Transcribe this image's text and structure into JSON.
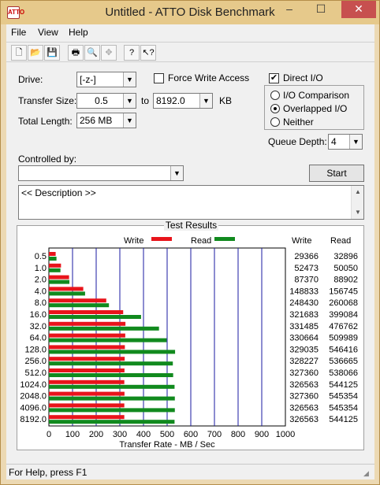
{
  "window": {
    "title": "Untitled - ATTO Disk Benchmark",
    "app_icon_glyph": "ATTO",
    "minimize": "–",
    "maximize": "☐",
    "close": "✕"
  },
  "menu": [
    "File",
    "View",
    "Help"
  ],
  "toolbar": [
    {
      "name": "new-icon",
      "glyph": "🗋"
    },
    {
      "name": "open-icon",
      "glyph": "📂"
    },
    {
      "name": "save-icon",
      "glyph": "💾"
    },
    {
      "name": "print-icon",
      "glyph": "🖶"
    },
    {
      "name": "print-preview-icon",
      "glyph": "🔍"
    },
    {
      "name": "move-icon",
      "glyph": "✥"
    },
    {
      "name": "help-icon",
      "glyph": "?"
    },
    {
      "name": "context-help-icon",
      "glyph": "↖?"
    }
  ],
  "settings": {
    "drive_label": "Drive:",
    "drive_value": "[-z-]",
    "transfer_size_label": "Transfer Size:",
    "transfer_from": "0.5",
    "to_label": "to",
    "transfer_to": "8192.0",
    "unit": "KB",
    "total_length_label": "Total Length:",
    "total_length_value": "256 MB",
    "force_write_label": "Force Write Access",
    "force_write_checked": false,
    "direct_io_label": "Direct I/O",
    "direct_io_checked": true,
    "io_comparison_label": "I/O Comparison",
    "overlapped_label": "Overlapped I/O",
    "neither_label": "Neither",
    "io_mode_selected": "Overlapped I/O",
    "queue_depth_label": "Queue Depth:",
    "queue_depth_value": "4",
    "controlled_by_label": "Controlled by:",
    "controlled_by_value": "",
    "start_label": "Start",
    "description_text": "<< Description >>"
  },
  "results": {
    "title": "Test Results",
    "write_header": "Write",
    "read_header": "Read",
    "legend_write": "Write",
    "legend_read": "Read",
    "write_color": "#e8141b",
    "read_color": "#118a1e"
  },
  "chart_data": {
    "type": "bar",
    "title": "Test Results",
    "orientation": "horizontal",
    "categories": [
      "0.5",
      "1.0",
      "2.0",
      "4.0",
      "8.0",
      "16.0",
      "32.0",
      "64.0",
      "128.0",
      "256.0",
      "512.0",
      "1024.0",
      "2048.0",
      "4096.0",
      "8192.0"
    ],
    "series": [
      {
        "name": "Write",
        "color": "#e8141b",
        "values": [
          29366,
          52473,
          87370,
          148833,
          248430,
          321683,
          331485,
          330664,
          329035,
          328227,
          327360,
          326563,
          327360,
          326563,
          326563
        ]
      },
      {
        "name": "Read",
        "color": "#118a1e",
        "values": [
          32896,
          50050,
          88902,
          156745,
          260068,
          399084,
          476762,
          509989,
          546416,
          536665,
          538066,
          544125,
          545354,
          545354,
          544125
        ]
      }
    ],
    "xlabel": "Transfer Rate - MB / Sec",
    "xticks": [
      "0",
      "100",
      "200",
      "300",
      "400",
      "500",
      "600",
      "700",
      "800",
      "900",
      "1000"
    ],
    "xlim": [
      0,
      1000
    ],
    "grid": true,
    "legend": "top"
  },
  "statusbar": {
    "text": "For Help, press F1"
  }
}
